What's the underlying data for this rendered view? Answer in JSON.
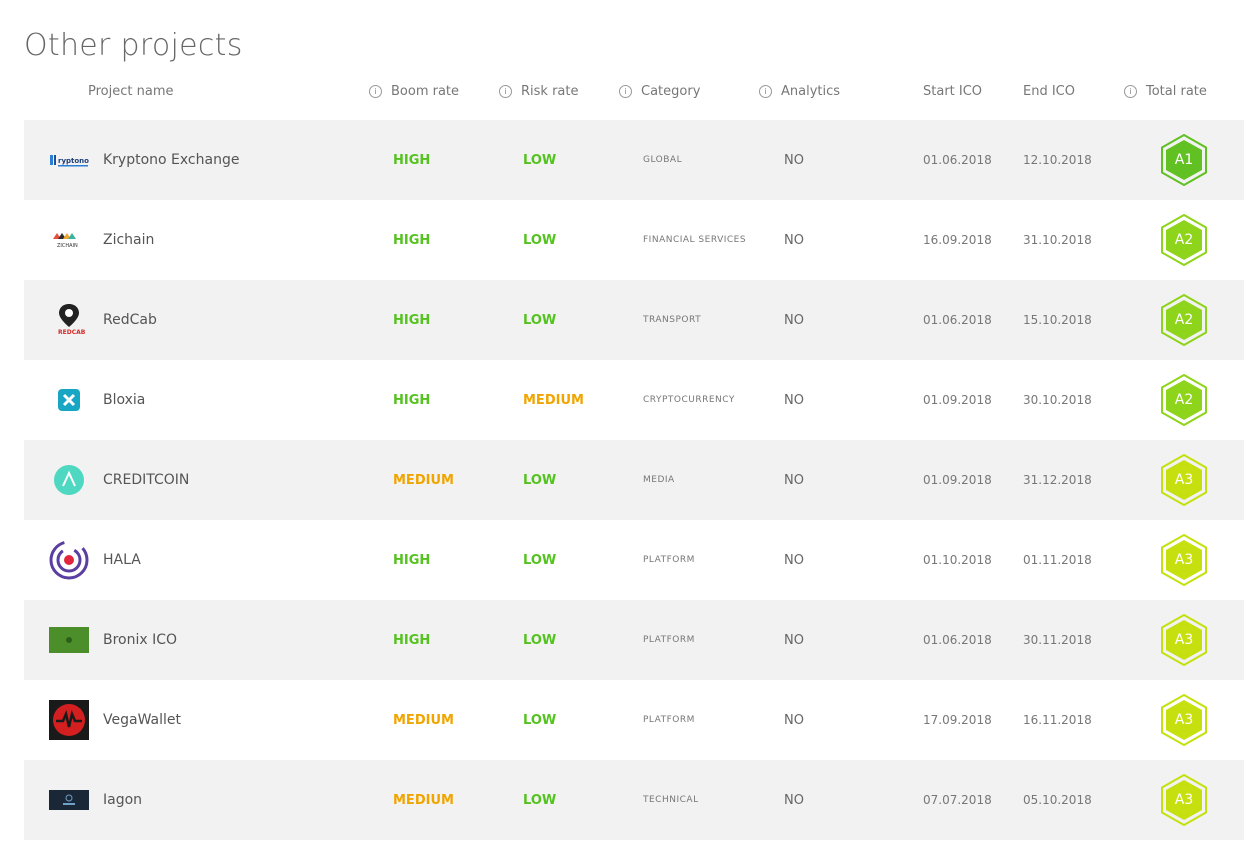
{
  "title": "Other projects",
  "columns": {
    "name": "Project name",
    "boom": "Boom rate",
    "risk": "Risk rate",
    "category": "Category",
    "analytics": "Analytics",
    "start": "Start ICO",
    "end": "End ICO",
    "total": "Total rate"
  },
  "colors": {
    "high": "#54c21f",
    "low": "#54c21f",
    "medium": "#f0a500",
    "a1": "#62c122",
    "a2": "#8ed41a",
    "a3": "#c6e00f"
  },
  "rows": [
    {
      "name": "Kryptono Exchange",
      "logo": "kryptono-logo",
      "boom": "HIGH",
      "risk": "LOW",
      "category": "GLOBAL",
      "analytics": "NO",
      "start": "01.06.2018",
      "end": "12.10.2018",
      "rate": "A1"
    },
    {
      "name": "Zichain",
      "logo": "zichain-logo",
      "boom": "HIGH",
      "risk": "LOW",
      "category": "FINANCIAL SERVICES",
      "analytics": "NO",
      "start": "16.09.2018",
      "end": "31.10.2018",
      "rate": "A2"
    },
    {
      "name": "RedCab",
      "logo": "redcab-logo",
      "boom": "HIGH",
      "risk": "LOW",
      "category": "TRANSPORT",
      "analytics": "NO",
      "start": "01.06.2018",
      "end": "15.10.2018",
      "rate": "A2"
    },
    {
      "name": "Bloxia",
      "logo": "bloxia-logo",
      "boom": "HIGH",
      "risk": "MEDIUM",
      "category": "CRYPTOCURRENCY",
      "analytics": "NO",
      "start": "01.09.2018",
      "end": "30.10.2018",
      "rate": "A2"
    },
    {
      "name": "CREDITCOIN",
      "logo": "creditcoin-logo",
      "boom": "MEDIUM",
      "risk": "LOW",
      "category": "MEDIA",
      "analytics": "NO",
      "start": "01.09.2018",
      "end": "31.12.2018",
      "rate": "A3"
    },
    {
      "name": "HALA",
      "logo": "hala-logo",
      "boom": "HIGH",
      "risk": "LOW",
      "category": "PLATFORM",
      "analytics": "NO",
      "start": "01.10.2018",
      "end": "01.11.2018",
      "rate": "A3"
    },
    {
      "name": "Bronix ICO",
      "logo": "bronix-logo",
      "boom": "HIGH",
      "risk": "LOW",
      "category": "PLATFORM",
      "analytics": "NO",
      "start": "01.06.2018",
      "end": "30.11.2018",
      "rate": "A3"
    },
    {
      "name": "VegaWallet",
      "logo": "vegawallet-logo",
      "boom": "MEDIUM",
      "risk": "LOW",
      "category": "PLATFORM",
      "analytics": "NO",
      "start": "17.09.2018",
      "end": "16.11.2018",
      "rate": "A3"
    },
    {
      "name": "Iagon",
      "logo": "iagon-logo",
      "boom": "MEDIUM",
      "risk": "LOW",
      "category": "TECHNICAL",
      "analytics": "NO",
      "start": "07.07.2018",
      "end": "05.10.2018",
      "rate": "A3"
    }
  ]
}
